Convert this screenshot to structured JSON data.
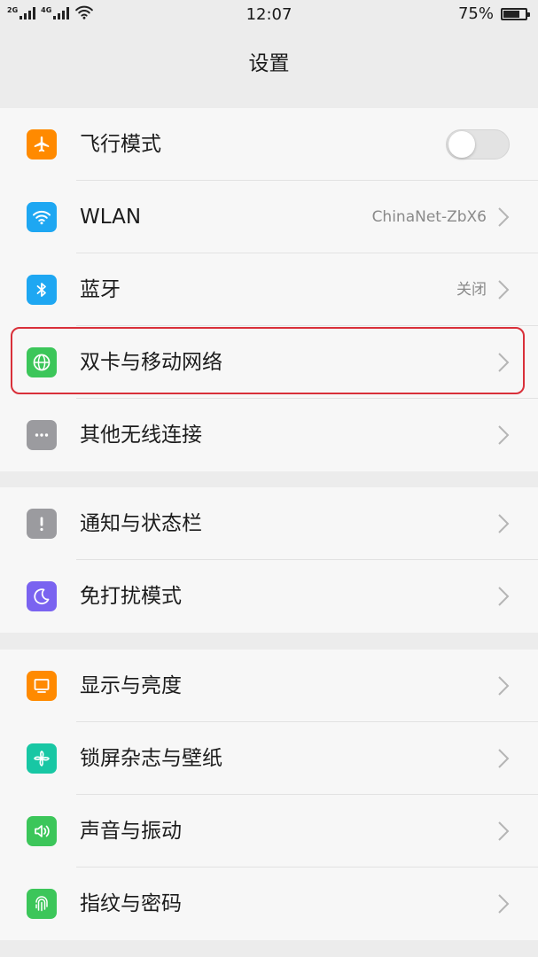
{
  "status_bar": {
    "network_1": "2G",
    "network_2": "4G",
    "time": "12:07",
    "battery_text": "75%",
    "battery_level": 0.75
  },
  "header": {
    "title": "设置"
  },
  "colors": {
    "orange": "#ff8a00",
    "blue": "#1ea7f2",
    "green": "#3cc65a",
    "gray": "#9b9b9f",
    "purple": "#7a63f0",
    "teal": "#18c7a4",
    "highlight": "#d9303a"
  },
  "groups": [
    {
      "items": [
        {
          "label": "飞行模式",
          "icon": "airplane-icon",
          "color": "#ff8a00",
          "toggle": true,
          "toggle_on": false
        },
        {
          "label": "WLAN",
          "icon": "wifi-icon",
          "color": "#1ea7f2",
          "value": "ChinaNet-ZbX6"
        },
        {
          "label": "蓝牙",
          "icon": "bluetooth-icon",
          "color": "#1ea7f2",
          "value": "关闭"
        },
        {
          "label": "双卡与移动网络",
          "icon": "globe-icon",
          "color": "#3cc65a",
          "highlighted": true
        },
        {
          "label": "其他无线连接",
          "icon": "more-icon",
          "color": "#9b9b9f"
        }
      ]
    },
    {
      "items": [
        {
          "label": "通知与状态栏",
          "icon": "notification-icon",
          "color": "#9b9b9f"
        },
        {
          "label": "免打扰模式",
          "icon": "moon-icon",
          "color": "#7a63f0"
        }
      ]
    },
    {
      "items": [
        {
          "label": "显示与亮度",
          "icon": "monitor-icon",
          "color": "#ff8a00"
        },
        {
          "label": "锁屏杂志与壁纸",
          "icon": "pinwheel-icon",
          "color": "#18c7a4"
        },
        {
          "label": "声音与振动",
          "icon": "speaker-icon",
          "color": "#3cc65a"
        },
        {
          "label": "指纹与密码",
          "icon": "fingerprint-icon",
          "color": "#3cc65a"
        }
      ]
    }
  ]
}
